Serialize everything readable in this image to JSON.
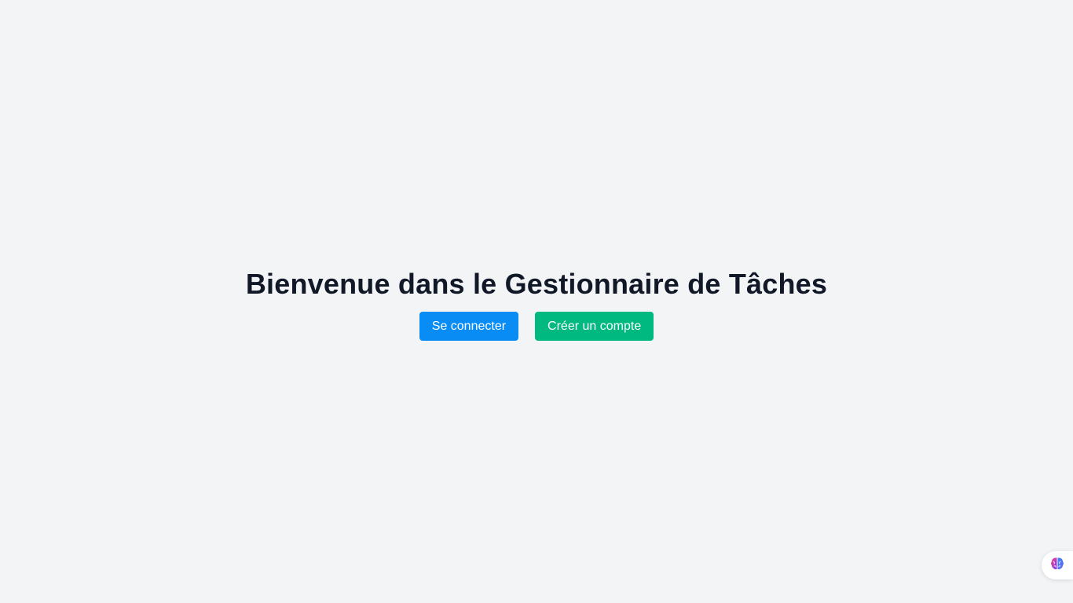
{
  "main": {
    "title": "Bienvenue dans le Gestionnaire de Tâches",
    "login_label": "Se connecter",
    "signup_label": "Créer un compte"
  },
  "colors": {
    "background": "#f3f4f6",
    "title": "#111827",
    "login_button": "#0a8cf5",
    "signup_button": "#00b981"
  },
  "widget": {
    "icon": "brain-icon"
  }
}
